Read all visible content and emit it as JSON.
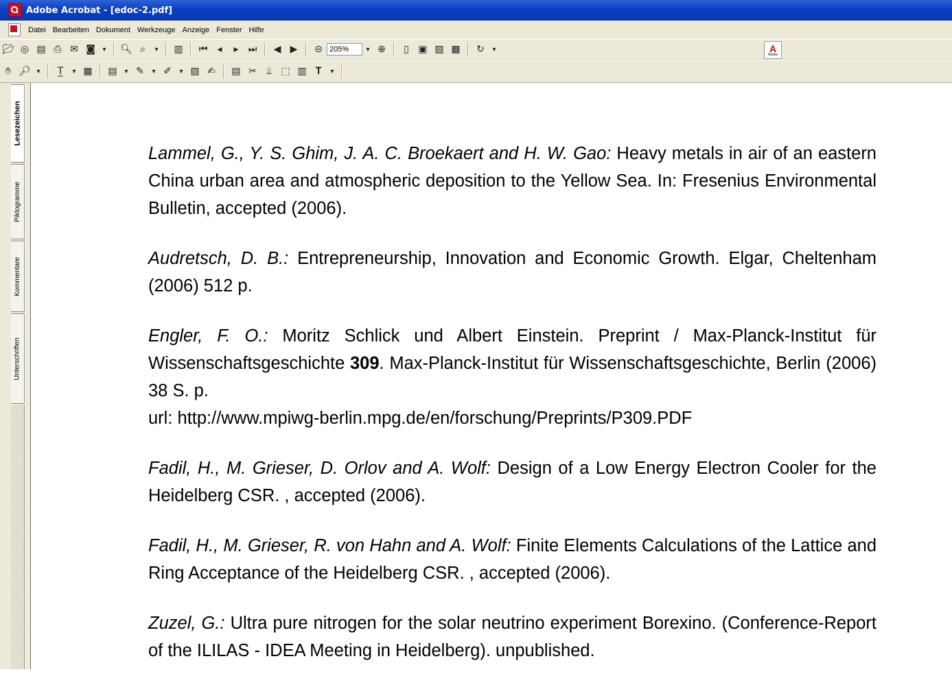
{
  "window": {
    "title": "Adobe Acrobat - [edoc-2.pdf]"
  },
  "menu": {
    "items": [
      "Datei",
      "Bearbeiten",
      "Dokument",
      "Werkzeuge",
      "Anzeige",
      "Fenster",
      "Hilfe"
    ]
  },
  "toolbar": {
    "zoom_value": "205%",
    "logo_text": "Adobe"
  },
  "side_tabs": {
    "bookmarks": "Lesezeichen",
    "thumbnails": "Piktogramme",
    "comments": "Kommentare",
    "signatures": "Unterschriften"
  },
  "document": {
    "references": [
      {
        "authors": "Lammel, G., Y. S. Ghim, J. A. C. Broekaert and H. W. Gao:",
        "text": " Heavy metals in air of an eastern China urban area and atmospheric deposition to the Yellow Sea. In: Fresenius Environmental Bulletin, accepted (2006)."
      },
      {
        "authors": "Audretsch, D. B.:",
        "text": " Entrepreneurship, Innovation and Economic Growth. Elgar, Cheltenham (2006) 512 p."
      },
      {
        "authors": "Engler, F. O.:",
        "text": " Moritz Schlick und Albert Einstein. Preprint / Max-Planck-Institut für Wissenschaftsgeschichte ",
        "bold": "309",
        "text2": ". Max-Planck-Institut für Wissenschaftsgeschichte, Berlin (2006) 38 S. p.",
        "url": "url: http://www.mpiwg-berlin.mpg.de/en/forschung/Preprints/P309.PDF"
      },
      {
        "authors": "Fadil, H., M. Grieser, D. Orlov and A. Wolf:",
        "text": " Design of a Low Energy Electron Cooler for the Heidelberg CSR. , accepted (2006)."
      },
      {
        "authors": "Fadil, H., M. Grieser, R. von Hahn and A. Wolf:",
        "text": " Finite Elements Calculations of the Lattice and Ring Acceptance of the Heidelberg CSR. , accepted (2006)."
      },
      {
        "authors": "Zuzel, G.:",
        "text": " Ultra pure nitrogen for the solar neutrino experiment Borexino. (Conference-Report of the ILILAS - IDEA Meeting in Heidelberg). unpublished."
      }
    ]
  }
}
